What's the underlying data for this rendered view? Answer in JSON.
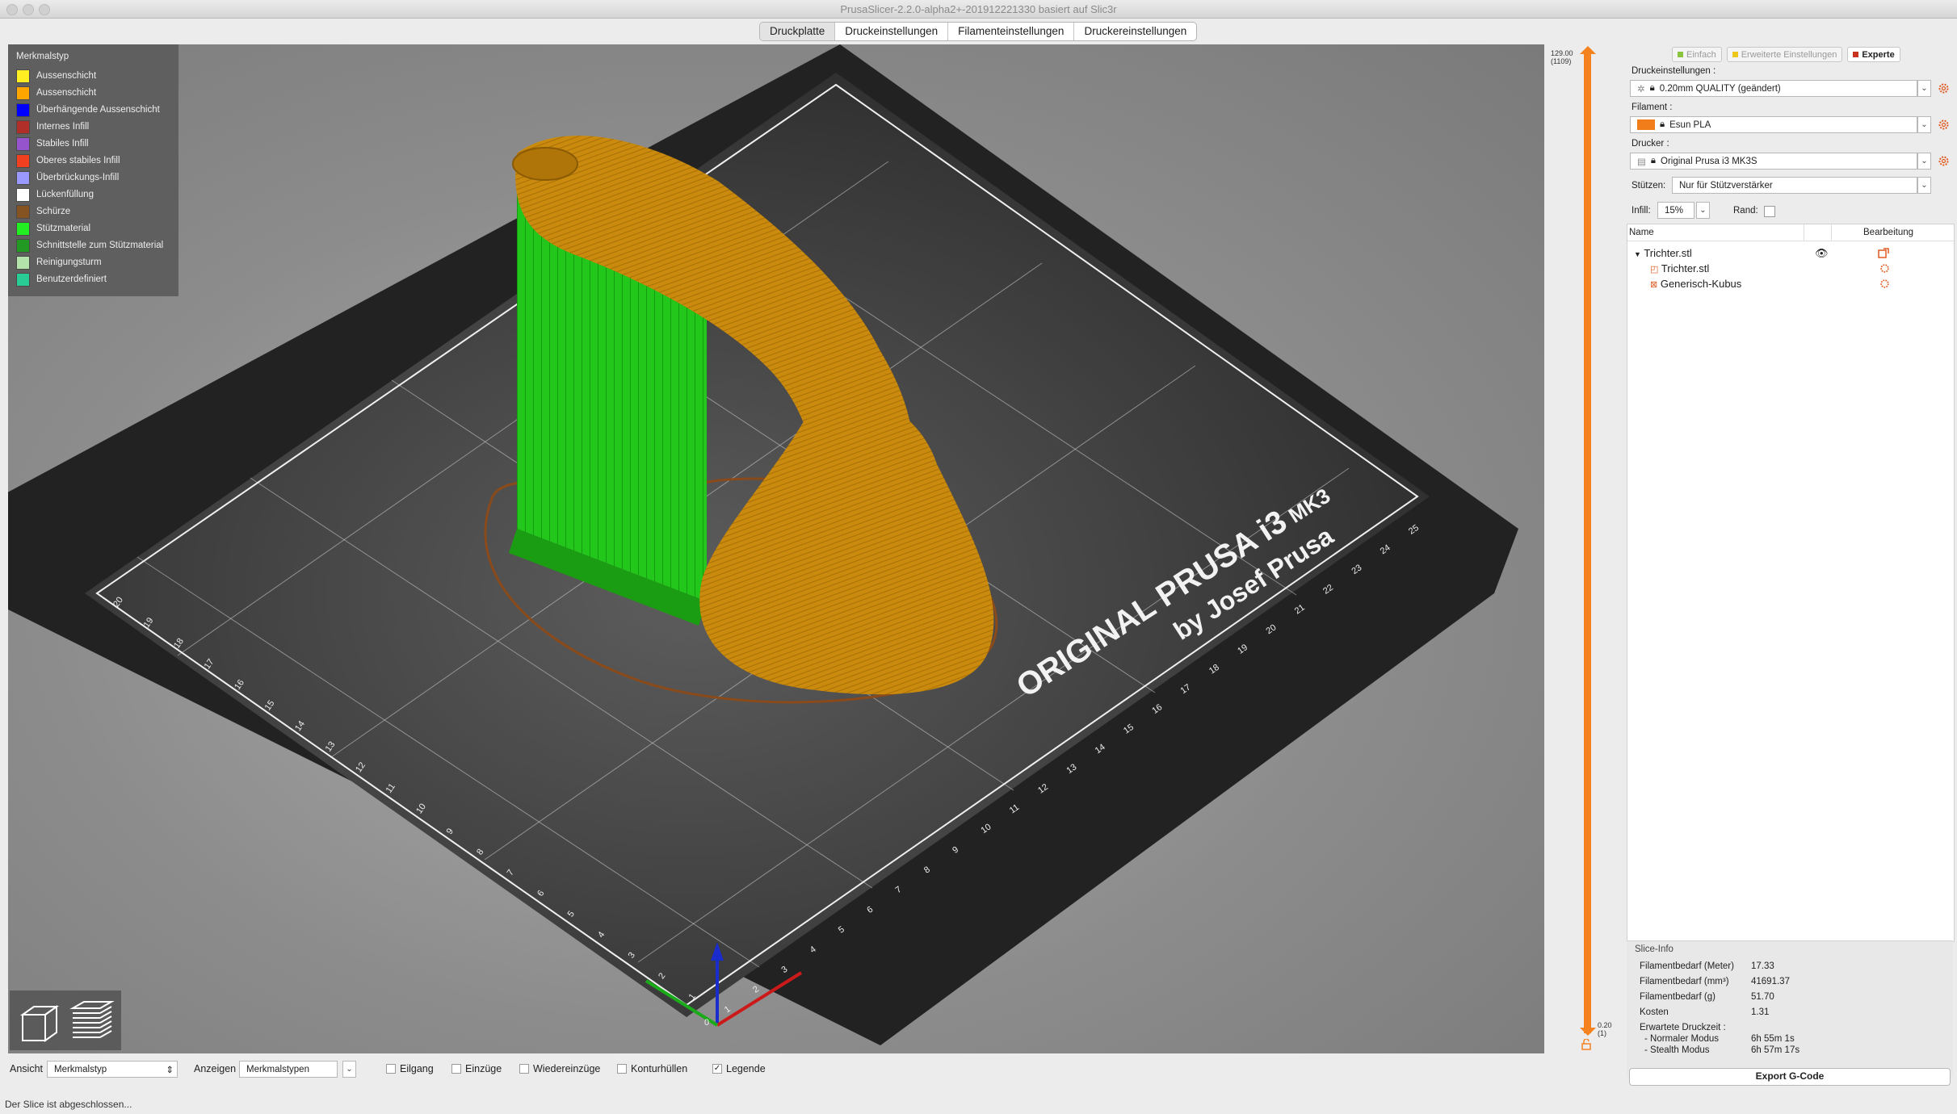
{
  "window": {
    "title": "PrusaSlicer-2.2.0-alpha2+-201912221330 basiert auf Slic3r"
  },
  "tabs": [
    "Druckplatte",
    "Druckeinstellungen",
    "Filamenteinstellungen",
    "Druckereinstellungen"
  ],
  "legend": {
    "title": "Merkmalstyp",
    "items": [
      {
        "label": "Aussenschicht",
        "color": "#ffee22"
      },
      {
        "label": "Aussenschicht",
        "color": "#ffa500"
      },
      {
        "label": "Überhängende Aussenschicht",
        "color": "#0000ff"
      },
      {
        "label": "Internes Infill",
        "color": "#b03029"
      },
      {
        "label": "Stabiles Infill",
        "color": "#9654cc"
      },
      {
        "label": "Oberes stabiles Infill",
        "color": "#f04020"
      },
      {
        "label": "Überbrückungs-Infill",
        "color": "#9999ff"
      },
      {
        "label": "Lückenfüllung",
        "color": "#ffffff"
      },
      {
        "label": "Schürze",
        "color": "#845321"
      },
      {
        "label": "Stützmaterial",
        "color": "#22ee22"
      },
      {
        "label": "Schnittstelle zum Stützmaterial",
        "color": "#229922"
      },
      {
        "label": "Reinigungsturm",
        "color": "#b3e3ab"
      },
      {
        "label": "Benutzerdefiniert",
        "color": "#28cc94"
      }
    ]
  },
  "bed": {
    "brand": "ORIGINAL PRUSA i3",
    "model": "MK3",
    "byline": "by Josef Prusa",
    "x_ticks": [
      "1",
      "2",
      "3",
      "4",
      "5",
      "6",
      "7",
      "8",
      "9",
      "10",
      "11",
      "12",
      "13",
      "14",
      "15",
      "16",
      "17",
      "18",
      "19",
      "20",
      "21",
      "22",
      "23",
      "24",
      "25"
    ],
    "y_ticks": [
      "1",
      "2",
      "3",
      "4",
      "5",
      "6",
      "7",
      "8",
      "9",
      "10",
      "11",
      "12",
      "13",
      "14",
      "15",
      "16",
      "17",
      "18",
      "19",
      "20"
    ],
    "origin": "0"
  },
  "layer_slider": {
    "top_value": "129.00",
    "top_layer": "(1109)",
    "bottom_value": "0.20",
    "bottom_layer": "(1)"
  },
  "modes": {
    "simple": "Einfach",
    "advanced": "Erweiterte Einstellungen",
    "expert": "Experte"
  },
  "settings": {
    "print_label": "Druckeinstellungen :",
    "print_value": "0.20mm QUALITY (geändert)",
    "filament_label": "Filament :",
    "filament_value": "Esun PLA",
    "filament_color": "#f07c1a",
    "printer_label": "Drucker :",
    "printer_value": "Original Prusa i3 MK3S",
    "supports_label": "Stützen:",
    "supports_value": "Nur für Stützverstärker",
    "infill_label": "Infill:",
    "infill_value": "15%",
    "brim_label": "Rand:"
  },
  "object_list": {
    "col_name": "Name",
    "col_edit": "Bearbeitung",
    "object": "Trichter.stl",
    "part": "Trichter.stl",
    "modifier": "Generisch-Kubus"
  },
  "slice_info": {
    "title": "Slice-Info",
    "rows": [
      {
        "label": "Filamentbedarf (Meter)",
        "value": "17.33"
      },
      {
        "label": "Filamentbedarf (mm³)",
        "value": "41691.37"
      },
      {
        "label": "Filamentbedarf (g)",
        "value": "51.70"
      },
      {
        "label": "Kosten",
        "value": "1.31"
      }
    ],
    "time_title": "Erwartete Druckzeit :",
    "normal_label": "- Normaler Modus",
    "normal_value": "6h 55m 1s",
    "stealth_label": "- Stealth Modus",
    "stealth_value": "6h 57m 17s"
  },
  "export_button": "Export G-Code",
  "bottom": {
    "view_label": "Ansicht",
    "view_value": "Merkmalstyp",
    "show_label": "Anzeigen",
    "show_value": "Merkmalstypen",
    "checkboxes": [
      {
        "label": "Eilgang",
        "checked": false
      },
      {
        "label": "Einzüge",
        "checked": false
      },
      {
        "label": "Wiedereinzüge",
        "checked": false
      },
      {
        "label": "Konturhüllen",
        "checked": false
      },
      {
        "label": "Legende",
        "checked": true
      }
    ]
  },
  "status": "Der Slice ist abgeschlossen..."
}
